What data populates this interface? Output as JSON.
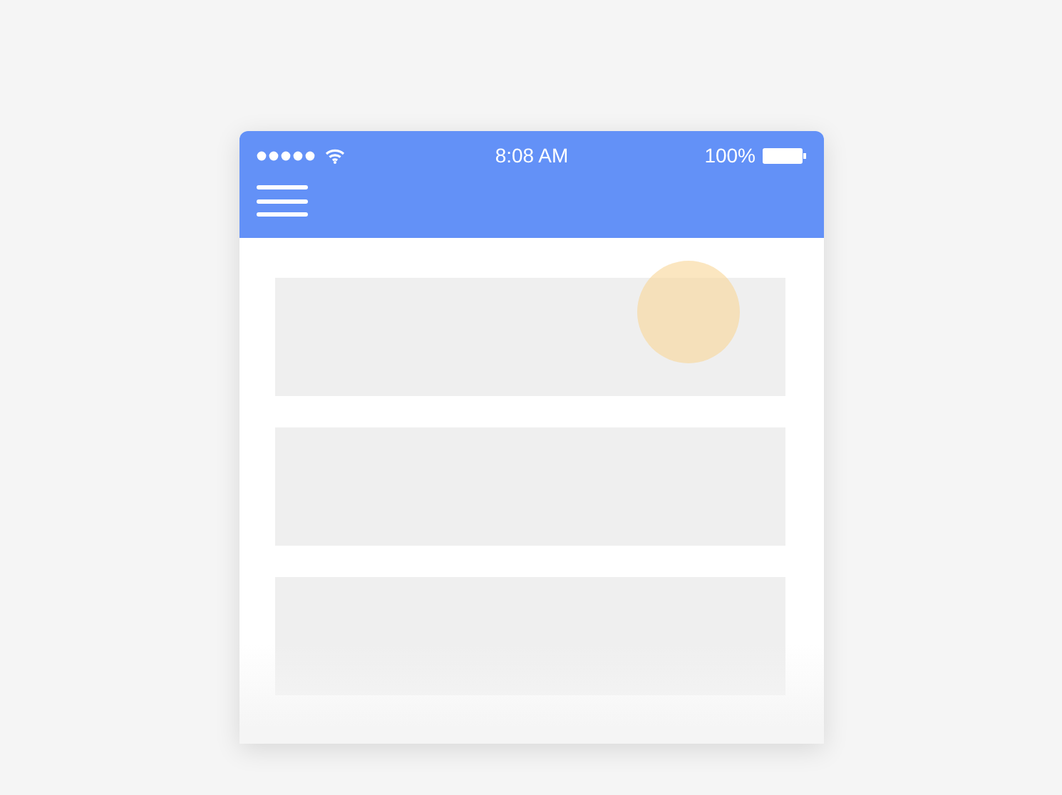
{
  "status_bar": {
    "time": "8:08 AM",
    "battery": "100%"
  },
  "cards": [
    {
      "kind": "placeholder",
      "touched": true
    },
    {
      "kind": "placeholder",
      "touched": false
    },
    {
      "kind": "placeholder",
      "touched": false
    }
  ]
}
